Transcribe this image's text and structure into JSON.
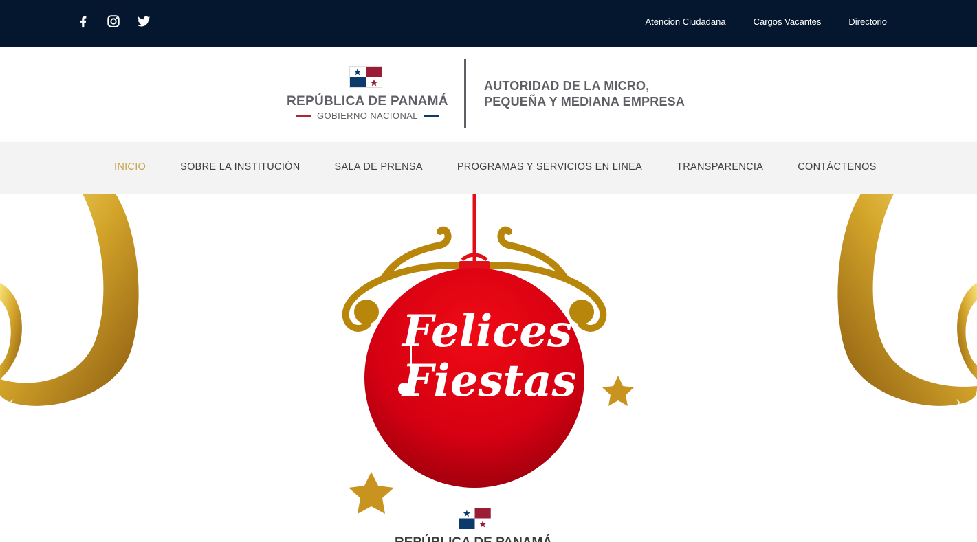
{
  "topbar": {
    "social": [
      "facebook-icon",
      "instagram-icon",
      "twitter-icon"
    ],
    "links": [
      "Atencion Ciudadana",
      "Cargos Vacantes",
      "Directorio"
    ]
  },
  "brand": {
    "country": "REPÚBLICA DE PANAMÁ",
    "government": "GOBIERNO NACIONAL",
    "authority_line1": "AUTORIDAD DE LA MICRO,",
    "authority_line2": "PEQUEÑA Y MEDIANA EMPRESA"
  },
  "nav": {
    "items": [
      "INICIO",
      "SOBRE LA INSTITUCIÓN",
      "SALA DE PRENSA",
      "PROGRAMAS Y SERVICIOS EN LINEA",
      "TRANSPARENCIA",
      "CONTÁCTENOS"
    ],
    "active": "INICIO"
  },
  "hero": {
    "greeting_line1": "Felices",
    "greeting_line2": "Fiestas",
    "footer_text": "REPÚBLICA DE PANAMÁ",
    "prev_arrow": "‹",
    "next_arrow": "›"
  },
  "colors": {
    "topbar": "#05162f",
    "nav_active": "#c9a24a",
    "ornament_red": "#d40012",
    "gold": "#b8860b",
    "flag_blue": "#0b3a6b",
    "flag_red": "#9b1c35"
  }
}
